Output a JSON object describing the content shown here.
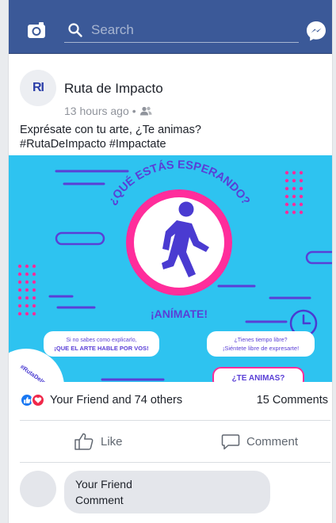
{
  "topbar": {
    "search_placeholder": "Search"
  },
  "post": {
    "avatar_initials": "RI",
    "author": "Ruta de Impacto",
    "timestamp": "13 hours ago",
    "caption_line1": "Exprésate con tu arte, ¿Te animas?",
    "caption_line2": "#RutaDeImpacto #Impactate",
    "image": {
      "headline": "¿QUÉ ESTÁS ESPERANDO?",
      "cta": "¡ANÍMATE!",
      "left_bubble_line1": "Si no sabes como explicarlo,",
      "left_bubble_line2": "¡QUE EL ARTE HABLE POR VOS!",
      "right_bubble_line1": "¿Tienes tiempo libre?",
      "right_bubble_line2": "¡Siéntete libre de expresarte!",
      "badge": "¿TE ANIMAS?",
      "corner_tag": "#RutaDeImpacto",
      "colors": {
        "bg": "#2ec3f0",
        "pink": "#ff2d9b",
        "purple": "#5a3fd6"
      }
    },
    "reactions_text": "Your Friend and 74 others",
    "comments_count": "15 Comments",
    "like_label": "Like",
    "comment_label": "Comment"
  },
  "comment": {
    "name": "Your Friend",
    "text": "Comment"
  },
  "colors": {
    "brand": "#3b5998",
    "like": "#1877f2",
    "love": "#f0284a"
  }
}
